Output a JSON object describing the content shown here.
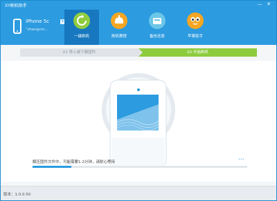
{
  "app": {
    "title": "XY刷机助手"
  },
  "window_controls": {
    "minimize": "—",
    "close": "✕"
  },
  "device": {
    "name": "iPhone 5c",
    "dropdown": "▾",
    "user": "\"zhangcm..."
  },
  "nav": [
    {
      "label": "一键刷机",
      "icon": "refresh-icon",
      "active": true
    },
    {
      "label": "刷机教程",
      "icon": "lamp-icon",
      "active": false
    },
    {
      "label": "备份还原",
      "icon": "backup-icon",
      "active": false
    },
    {
      "label": "苹果助手",
      "icon": "apple-helper-icon",
      "active": false
    }
  ],
  "steps": {
    "step1": "01 导入或下载固件",
    "step2": "02 开始刷机"
  },
  "status": {
    "text": "解压固件文件中，可能需要1-2分钟，请耐心等待",
    "progress_fraction": 0.18,
    "mark": "•••"
  },
  "footer": {
    "version": "版本：1.0.0.50"
  },
  "colors": {
    "header": "#2c9be0",
    "accent_green": "#8dcb3d",
    "nav_active": "#1778bf"
  }
}
